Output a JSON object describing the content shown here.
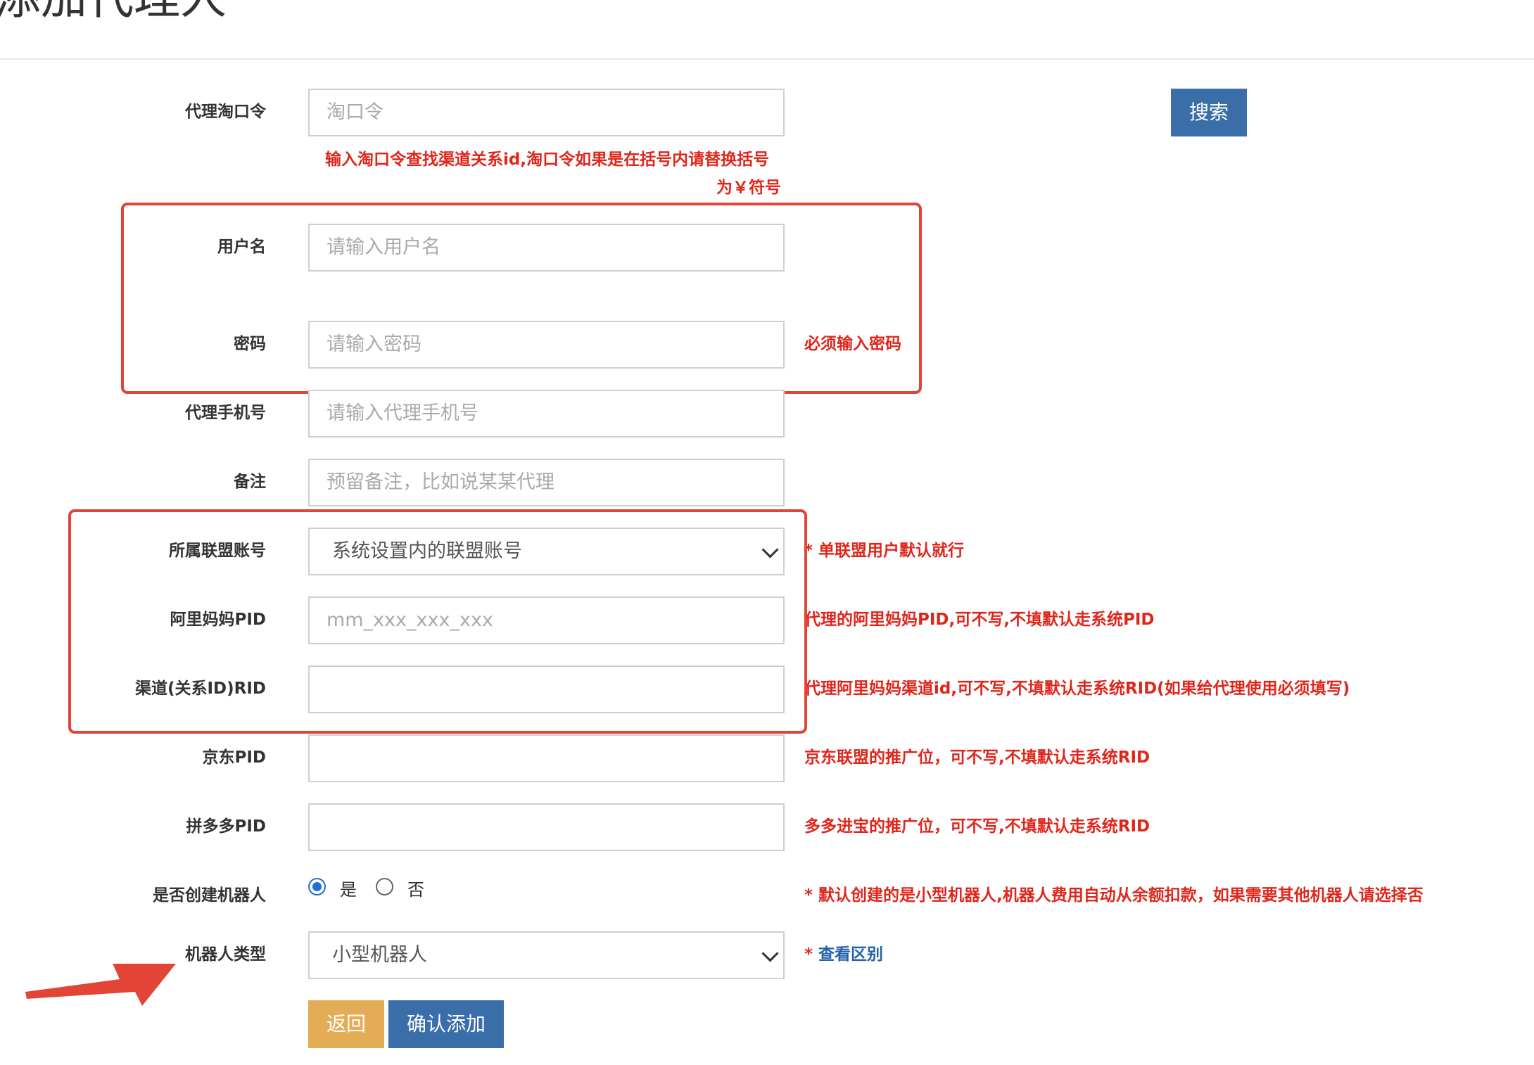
{
  "page": {
    "title": "添加代理人"
  },
  "search": {
    "label": "代理淘口令",
    "placeholder": "淘口令",
    "button": "搜索",
    "hint_line1": "输入淘口令查找渠道关系id,淘口令如果是在括号内请替换括号",
    "hint_line2": "为￥符号"
  },
  "username": {
    "label": "用户名",
    "placeholder": "请输入用户名"
  },
  "password": {
    "label": "密码",
    "placeholder": "请输入密码",
    "hint": "必须输入密码"
  },
  "phone": {
    "label": "代理手机号",
    "placeholder": "请输入代理手机号"
  },
  "remark": {
    "label": "备注",
    "placeholder": "预留备注，比如说某某代理"
  },
  "alliance": {
    "label": "所属联盟账号",
    "selected": "系统设置内的联盟账号",
    "hint": "* 单联盟用户默认就行"
  },
  "alimama_pid": {
    "label": "阿里妈妈PID",
    "placeholder": "mm_xxx_xxx_xxx",
    "hint": "代理的阿里妈妈PID,可不写,不填默认走系统PID"
  },
  "channel_rid": {
    "label": "渠道(关系ID)RID",
    "value": "",
    "hint": "代理阿里妈妈渠道id,可不写,不填默认走系统RID(如果给代理使用必须填写)"
  },
  "jd_pid": {
    "label": "京东PID",
    "value": "",
    "hint": "京东联盟的推广位，可不写,不填默认走系统RID"
  },
  "pdd_pid": {
    "label": "拼多多PID",
    "value": "",
    "hint": "多多进宝的推广位，可不写,不填默认走系统RID"
  },
  "create_robot": {
    "label": "是否创建机器人",
    "option_yes": "是",
    "option_no": "否",
    "selected": "是",
    "hint": "* 默认创建的是小型机器人,机器人费用自动从余额扣款，如果需要其他机器人请选择否"
  },
  "robot_type": {
    "label": "机器人类型",
    "selected": "小型机器人",
    "hint_star": "* ",
    "hint_link": "查看区别"
  },
  "actions": {
    "back": "返回",
    "submit": "确认添加"
  },
  "colors": {
    "annotation": "#e24535",
    "primary": "#3a6ea8",
    "warning": "#e4ad55",
    "hint": "#e0261b"
  }
}
